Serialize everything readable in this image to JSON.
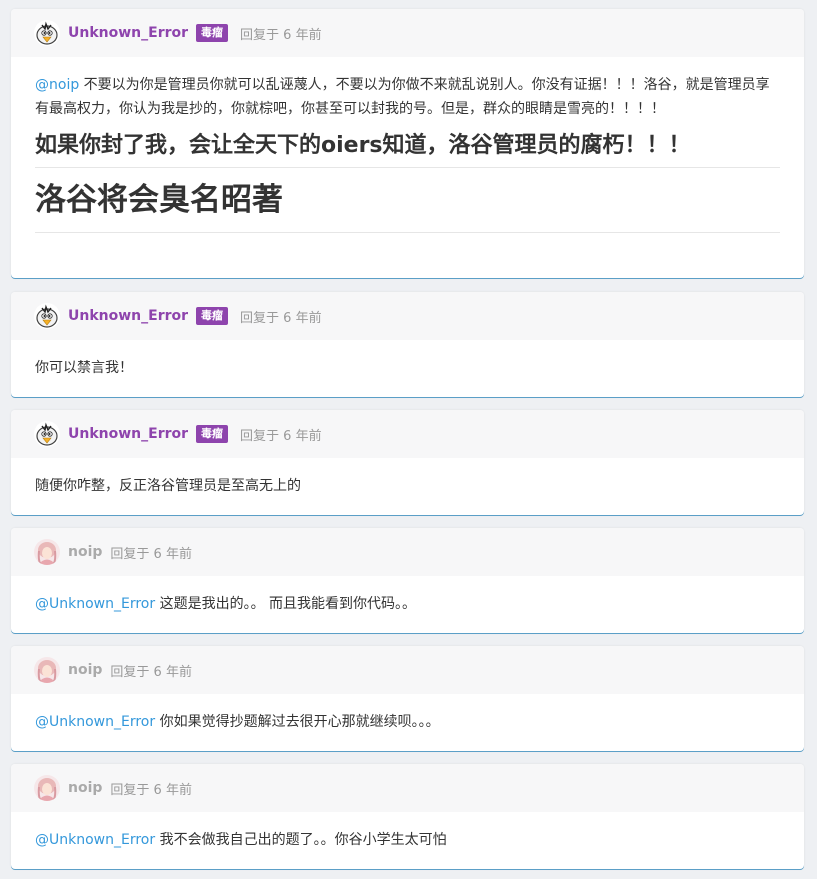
{
  "replies": [
    {
      "user": "Unknown_Error",
      "badge": "毒瘤",
      "time": "回复于 6 年前",
      "mention": "@noip",
      "text": " 不要以为你是管理员你就可以乱诬蔑人，不要以为你做不来就乱说别人。你没有证据！！！洛谷，就是管理员享有最高权力，你认为我是抄的，你就棕吧，你甚至可以封我的号。但是，群众的眼睛是雪亮的！！！！",
      "heading2": "如果你封了我，会让全天下的oiers知道，洛谷管理员的腐朽！！！",
      "heading1": "洛谷将会臭名昭著"
    },
    {
      "user": "Unknown_Error",
      "badge": "毒瘤",
      "time": "回复于 6 年前",
      "text": "你可以禁言我！"
    },
    {
      "user": "Unknown_Error",
      "badge": "毒瘤",
      "time": "回复于 6 年前",
      "text": "随便你咋整，反正洛谷管理员是至高无上的"
    },
    {
      "user": "noip",
      "time": "回复于 6 年前",
      "mention": "@Unknown_Error",
      "text": " 这题是我出的。。 而且我能看到你代码。。"
    },
    {
      "user": "noip",
      "time": "回复于 6 年前",
      "mention": "@Unknown_Error",
      "text": " 你如果觉得抄题解过去很开心那就继续呗。。。"
    },
    {
      "user": "noip",
      "time": "回复于 6 年前",
      "mention": "@Unknown_Error",
      "text": " 我不会做我自己出的题了。。你谷小学生太可怕"
    }
  ],
  "colors": {
    "username_purple": "#8e44ad",
    "username_gray": "#aaaaaa",
    "mention": "#3498db",
    "badge_bg": "#8e44ad",
    "card_border": "#5b9fc7"
  },
  "icons": {
    "unknown_error_avatar": "white-bird-avatar-icon",
    "noip_avatar": "anime-girl-avatar-icon"
  }
}
